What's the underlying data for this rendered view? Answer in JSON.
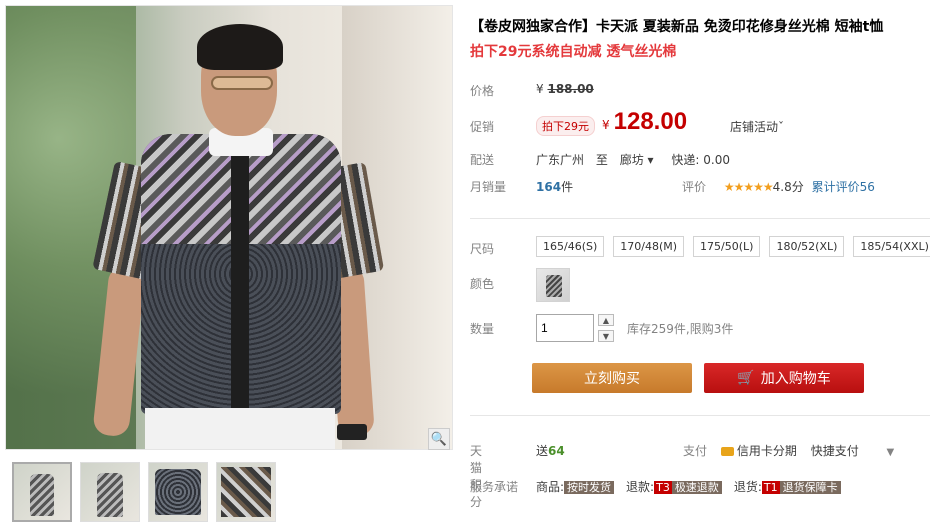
{
  "product": {
    "title": "【卷皮网独家合作】卡天派 夏装新品 免烫印花修身丝光棉 短袖t恤",
    "subtitle": "拍下29元系统自动减 透气丝光棉"
  },
  "price": {
    "label": "价格",
    "currency": "¥",
    "original": "188.00"
  },
  "promo": {
    "label": "促销",
    "tag": "拍下29元",
    "currency": "¥",
    "price": "128.00",
    "store_activity": "店铺活动"
  },
  "delivery": {
    "label": "配送",
    "origin": "广东广州",
    "to": "至",
    "destination": "廊坊",
    "fee": "快递: 0.00"
  },
  "sales": {
    "label": "月销量",
    "count": "164",
    "unit": "件",
    "rating_label": "评价",
    "stars": "★★★★★",
    "score": "4.8分",
    "reviews": "累计评价56"
  },
  "options": {
    "size_label": "尺码",
    "sizes": [
      "165/46(S)",
      "170/48(M)",
      "175/50(L)",
      "180/52(XL)",
      "185/54(XXL)"
    ],
    "color_label": "颜色",
    "quantity_label": "数量",
    "quantity_value": "1",
    "stock": "库存259件,限购3件"
  },
  "actions": {
    "buy_now": "立刻购买",
    "add_to_cart": "加入购物车"
  },
  "points": {
    "label": "天猫积分",
    "prefix": "送",
    "value": "64"
  },
  "payment": {
    "label": "支付",
    "credit": "信用卡分期",
    "quick": "快捷支付"
  },
  "services": {
    "label": "服务承诺",
    "items": [
      {
        "prefix": "商品:",
        "badge": "按时发货"
      },
      {
        "prefix": "退款:",
        "code": "T3",
        "badge": "极速退款"
      },
      {
        "prefix": "退货:",
        "code": "T1",
        "badge": "退货保障卡"
      }
    ]
  },
  "colors": {
    "accent_red": "#c40000",
    "buy_button": "#d88f3f",
    "cart_button": "#c81414",
    "link_blue": "#2f71a4"
  },
  "icons": {
    "zoom": "magnifier-icon",
    "cart": "shopping-cart-icon",
    "card": "credit-card-icon"
  }
}
